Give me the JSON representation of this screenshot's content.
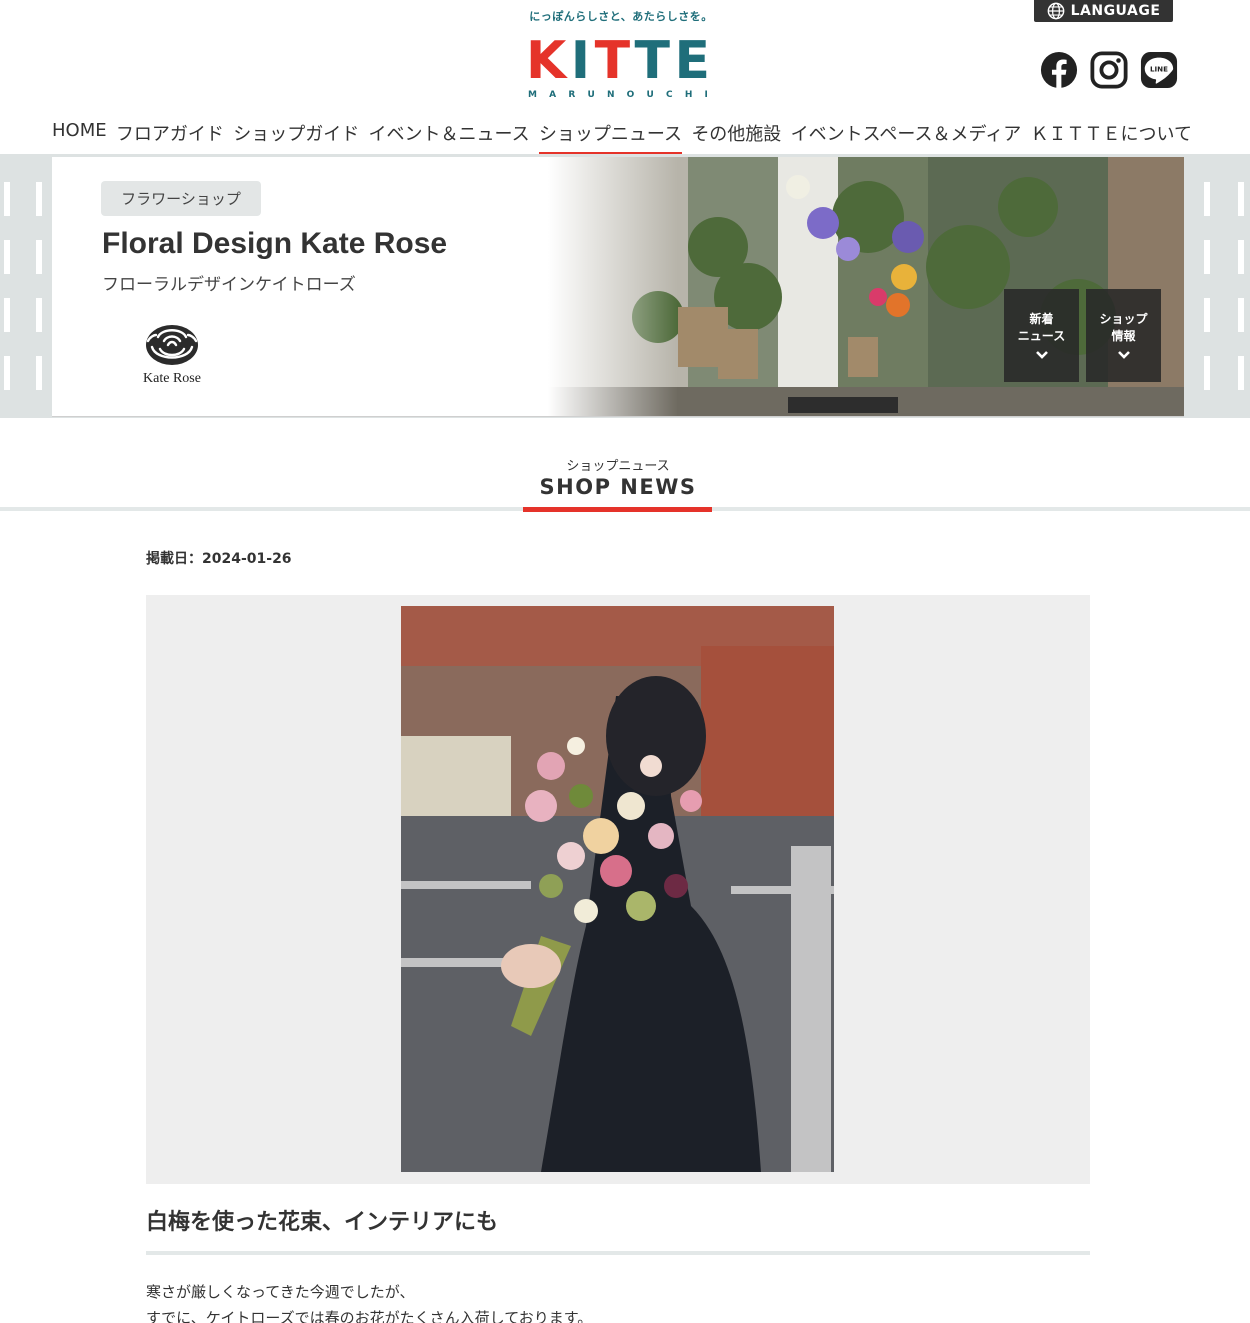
{
  "header": {
    "tagline": "にっぽんらしさと、あたらしさを。",
    "logo_letters": [
      "K",
      "I",
      "T",
      "T",
      "E"
    ],
    "logo_colors": [
      "#e5332a",
      "#1f6e7a",
      "#e5332a",
      "#1f6e7a",
      "#1f6e7a"
    ],
    "logo_sub_letters": [
      "M",
      "A",
      "R",
      "U",
      "N",
      "O",
      "U",
      "C",
      "H",
      "I"
    ],
    "language_label": "LANGUAGE",
    "social": {
      "facebook_icon": "facebook-icon",
      "instagram_icon": "instagram-icon",
      "line_icon": "line-icon",
      "line_text": "LINE"
    }
  },
  "nav": {
    "items": [
      {
        "label": "HOME"
      },
      {
        "label": "フロアガイド"
      },
      {
        "label": "ショップガイド"
      },
      {
        "label": "イベント＆ニュース"
      },
      {
        "label": "ショップニュース",
        "active": true
      },
      {
        "label": "その他施設"
      },
      {
        "label": "イベントスペース＆メディア"
      },
      {
        "label": "ＫＩＴＴＥについて"
      }
    ],
    "active_color": "#e5332a"
  },
  "shop": {
    "category": "フラワーショップ",
    "name": "Floral Design Kate Rose",
    "name_kana": "フローラルデザインケイトローズ",
    "logo_text": "Kate Rose",
    "jump_news_line1": "新着",
    "jump_news_line2": "ニュース",
    "jump_info_line1": "ショップ",
    "jump_info_line2": "情報"
  },
  "section": {
    "kana": "ショップニュース",
    "title": "SHOP NEWS"
  },
  "article": {
    "date_label": "掲載日：",
    "date": "2024-01-26",
    "title": "白梅を使った花束、インテリアにも",
    "body_lines": [
      "寒さが厳しくなってきた今週でしたが、",
      "すでに、ケイトローズでは春のお花がたくさん入荷しております。"
    ]
  }
}
